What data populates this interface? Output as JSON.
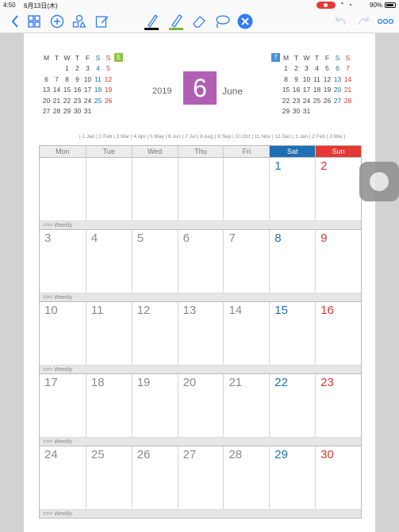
{
  "status": {
    "time": "4:50",
    "date": "6月13日(木)",
    "battery": "90%"
  },
  "toolbar": {
    "back": "back-chevron",
    "items": [
      "grid-icon",
      "add-icon",
      "shapes-icon",
      "compose-icon",
      "pen-icon",
      "highlighter-icon",
      "eraser-icon",
      "lasso-icon",
      "close-icon",
      "undo-icon",
      "redo-icon",
      "more-icon"
    ]
  },
  "header": {
    "year": "2019",
    "month_number": "6",
    "month_name": "June"
  },
  "mini_prev": {
    "badge": "5",
    "badge_color": "#8cc63f",
    "weekday_headers": [
      "M",
      "T",
      "W",
      "T",
      "F",
      "S",
      "S"
    ],
    "weeks": [
      [
        "",
        "",
        "1",
        "2",
        "3",
        "4",
        "5"
      ],
      [
        "6",
        "7",
        "8",
        "9",
        "10",
        "11",
        "12"
      ],
      [
        "13",
        "14",
        "15",
        "16",
        "17",
        "18",
        "19"
      ],
      [
        "20",
        "21",
        "22",
        "23",
        "24",
        "25",
        "26"
      ],
      [
        "27",
        "28",
        "29",
        "30",
        "31",
        "",
        ""
      ]
    ]
  },
  "mini_next": {
    "badge": "7",
    "badge_color": "#4a90d9",
    "weekday_headers": [
      "M",
      "T",
      "W",
      "T",
      "F",
      "S",
      "S"
    ],
    "weeks": [
      [
        "1",
        "2",
        "3",
        "4",
        "5",
        "6",
        "7"
      ],
      [
        "8",
        "9",
        "10",
        "11",
        "12",
        "13",
        "14"
      ],
      [
        "15",
        "16",
        "17",
        "18",
        "19",
        "20",
        "21"
      ],
      [
        "22",
        "23",
        "24",
        "25",
        "26",
        "27",
        "28"
      ],
      [
        "29",
        "30",
        "31",
        "",
        "",
        "",
        ""
      ]
    ]
  },
  "timeline": "| 1 Jan | 2 Feb | 3 Mar | 4 Apr | 5 May | 6 Jun | 7 Jul | 8 Aug | 9 Sep | 10 Oct | 11 Nov | 12 Dec | 1 Jan | 2 Feb | 3 Mar |",
  "calendar": {
    "weekdays": [
      "Mon",
      "Tue",
      "Wed",
      "Thu",
      "Fri",
      "Sat",
      "Sun"
    ],
    "weekly_label": ">>> Weekly",
    "weeks": [
      [
        "",
        "",
        "",
        "",
        "",
        "1",
        "2"
      ],
      [
        "3",
        "4",
        "5",
        "6",
        "7",
        "8",
        "9"
      ],
      [
        "10",
        "11",
        "12",
        "13",
        "14",
        "15",
        "16"
      ],
      [
        "17",
        "18",
        "19",
        "20",
        "21",
        "22",
        "23"
      ],
      [
        "24",
        "25",
        "26",
        "27",
        "28",
        "29",
        "30"
      ]
    ]
  },
  "colors": {
    "accent": "#2f7cf6",
    "month_box": "#b15fb4",
    "saturday": "#1f6fb5",
    "sunday": "#e53935"
  }
}
